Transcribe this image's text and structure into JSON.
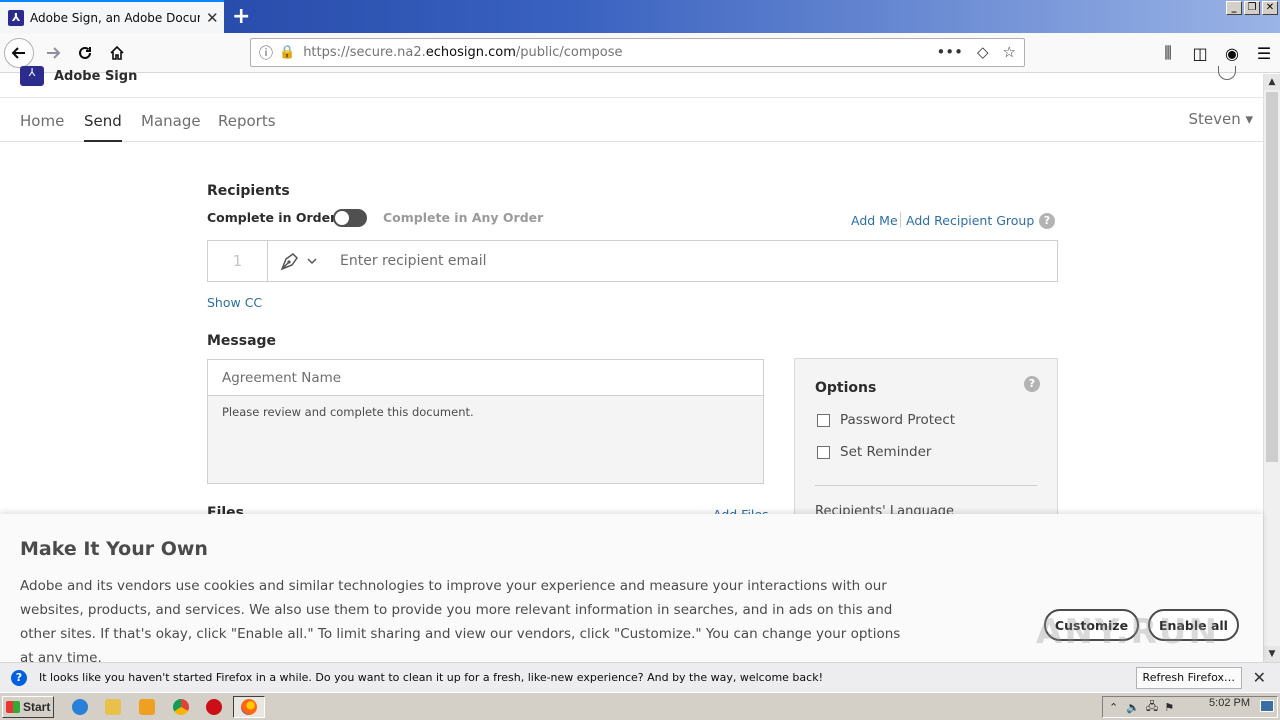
{
  "browser": {
    "tab_title": "Adobe Sign, an Adobe Document Cloud",
    "tab_favicon": "adobe-sign-icon",
    "new_tab_label": "+",
    "url_prefix": "https://secure.na2.",
    "url_domain": "echosign.com",
    "url_path": "/public/compose",
    "url_more": "•••",
    "window_buttons": [
      "_",
      "▫",
      "✕"
    ]
  },
  "app": {
    "logo_text": "Adobe Sign",
    "nav": [
      "Home",
      "Send",
      "Manage",
      "Reports"
    ],
    "active_nav": "Send",
    "user": "Steven ▾"
  },
  "recipients": {
    "heading": "Recipients",
    "complete_in_order": "Complete in Order",
    "complete_any_order": "Complete in Any Order",
    "add_me": "Add Me",
    "add_recipient_group": "Add Recipient Group",
    "row_number": "1",
    "email_placeholder": "Enter recipient email",
    "show_cc": "Show CC"
  },
  "message": {
    "heading": "Message",
    "agreement_placeholder": "Agreement Name",
    "message_text": "Please review and complete this document."
  },
  "files": {
    "heading": "Files",
    "add_files": "Add Files"
  },
  "options": {
    "title": "Options",
    "password_protect": "Password Protect",
    "set_reminder": "Set Reminder",
    "recipients_language": "Recipients' Language"
  },
  "cookie_banner": {
    "title": "Make It Your Own",
    "text": "Adobe and its vendors use cookies and similar technologies to improve your experience and measure your interactions with our websites, products, and services. We also use them to provide you more relevant information in searches, and in ads on this and other sites. If that's okay, click \"Enable all.\" To limit sharing and view our vendors, click \"Customize.\" You can change your options at any time.",
    "customize": "Customize",
    "enable_all": "Enable all"
  },
  "watermark": "ANY.RUN",
  "notification": {
    "text": "It looks like you haven't started Firefox in a while. Do you want to clean it up for a fresh, like-new experience? And by the way, welcome back!",
    "button": "Refresh Firefox…"
  },
  "taskbar": {
    "start": "Start",
    "clock": "5:02 PM"
  }
}
